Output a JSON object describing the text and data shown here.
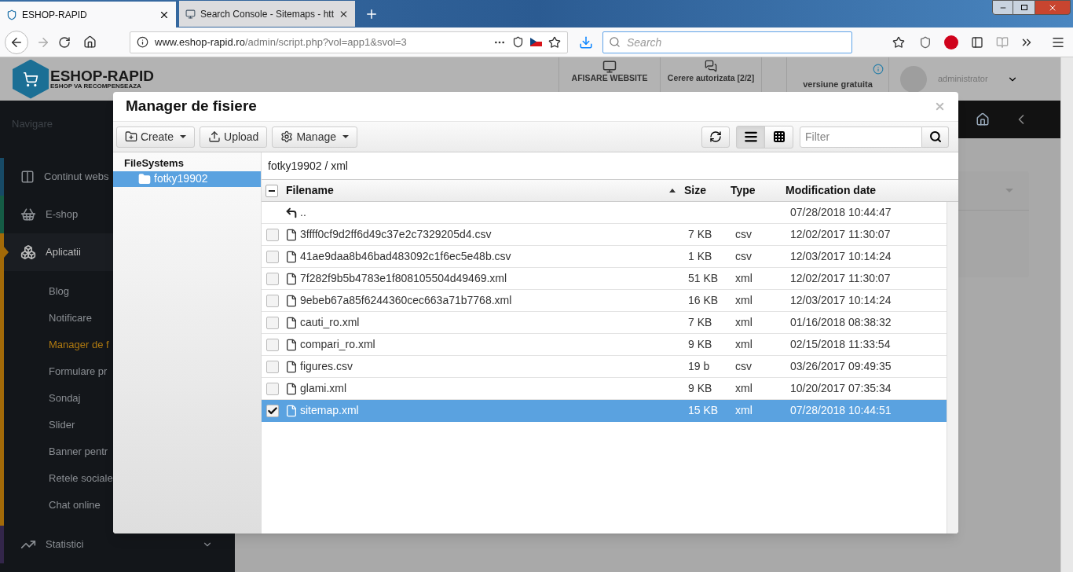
{
  "browser": {
    "tabs": [
      {
        "title": "ESHOP-RAPID",
        "selected": true
      },
      {
        "title": "Search Console - Sitemaps - htt",
        "selected": false
      }
    ],
    "url_host": "www.eshop-rapid.ro",
    "url_path": "/admin/script.php?vol=app1&svol=3",
    "search": {
      "placeholder": "Search"
    }
  },
  "site": {
    "logo": {
      "title": "ESHOP-RAPID",
      "subtitle": "ESHOP VA RECOMPENSEAZA"
    },
    "header_items": [
      {
        "label": "AFISARE WEBSITE",
        "kind": "monitor"
      },
      {
        "label": "Cerere autorizata [2/2]",
        "kind": "chat"
      }
    ],
    "version": "versiune gratuita",
    "user": "administrator",
    "sidebar": {
      "heading": "Navigare",
      "items": [
        {
          "label": "Continut webs",
          "kind": "columns",
          "color": "#174a66",
          "selected": false
        },
        {
          "label": "E-shop",
          "kind": "basket",
          "color": "#155c45",
          "selected": false
        },
        {
          "label": "Aplicatii",
          "kind": "cubes",
          "color": "#a36a08",
          "selected": true,
          "children": [
            {
              "label": "Blog",
              "selected": false
            },
            {
              "label": "Notificare",
              "selected": false
            },
            {
              "label": "Manager de f",
              "selected": true
            },
            {
              "label": "Formulare pr",
              "selected": false
            },
            {
              "label": "Sondaj",
              "selected": false
            },
            {
              "label": "Slider",
              "selected": false
            },
            {
              "label": "Banner pentr",
              "selected": false
            },
            {
              "label": "Retele sociale",
              "selected": false
            },
            {
              "label": "Chat online",
              "selected": false
            }
          ]
        },
        {
          "label": "Statistici",
          "kind": "chart",
          "color": "#33264a",
          "selected": false
        }
      ]
    }
  },
  "modal": {
    "title": "Manager de fisiere",
    "toolbar": [
      {
        "label": "Create",
        "kind": "create"
      },
      {
        "label": "Upload",
        "kind": "upload"
      },
      {
        "label": "Manage",
        "kind": "manage"
      }
    ],
    "views": [
      {
        "kind": "list",
        "selected": true
      },
      {
        "kind": "grid",
        "selected": false
      }
    ],
    "filter": {
      "placeholder": "Filter"
    },
    "tree": {
      "label": "FileSystems",
      "children": [
        {
          "label": "fotky19902",
          "selected": true
        }
      ]
    },
    "breadcrumb": "fotky19902 / xml",
    "select_all": {
      "indeterminate": true
    },
    "columns": [
      {
        "label": "Filename",
        "sorted": true
      },
      {
        "label": "Size",
        "sorted": false
      },
      {
        "label": "Type",
        "sorted": false
      },
      {
        "label": "Modification date",
        "sorted": false
      }
    ],
    "rows": [
      {
        "kind": "parent",
        "name": "..",
        "size": "",
        "type": "",
        "date": "07/28/2018 10:44:47",
        "selected": false
      },
      {
        "kind": "file",
        "name": "3ffff0cf9d2ff6d49c37e2c7329205d4.csv",
        "size": "7 KB",
        "type": "csv",
        "date": "12/02/2017 11:30:07",
        "selected": false
      },
      {
        "kind": "file",
        "name": "41ae9daa8b46bad483092c1f6ec5e48b.csv",
        "size": "1 KB",
        "type": "csv",
        "date": "12/03/2017 10:14:24",
        "selected": false
      },
      {
        "kind": "file",
        "name": "7f282f9b5b4783e1f808105504d49469.xml",
        "size": "51 KB",
        "type": "xml",
        "date": "12/02/2017 11:30:07",
        "selected": false
      },
      {
        "kind": "file",
        "name": "9ebeb67a85f6244360cec663a71b7768.xml",
        "size": "16 KB",
        "type": "xml",
        "date": "12/03/2017 10:14:24",
        "selected": false
      },
      {
        "kind": "file",
        "name": "cauti_ro.xml",
        "size": "7 KB",
        "type": "xml",
        "date": "01/16/2018 08:38:32",
        "selected": false
      },
      {
        "kind": "file",
        "name": "compari_ro.xml",
        "size": "9 KB",
        "type": "xml",
        "date": "02/15/2018 11:33:54",
        "selected": false
      },
      {
        "kind": "file",
        "name": "figures.csv",
        "size": "19 b",
        "type": "csv",
        "date": "03/26/2017 09:49:35",
        "selected": false
      },
      {
        "kind": "file",
        "name": "glami.xml",
        "size": "9 KB",
        "type": "xml",
        "date": "10/20/2017 07:35:34",
        "selected": false
      },
      {
        "kind": "file",
        "name": "sitemap.xml",
        "size": "15 KB",
        "type": "xml",
        "date": "07/28/2018 10:44:51",
        "selected": true
      }
    ]
  }
}
